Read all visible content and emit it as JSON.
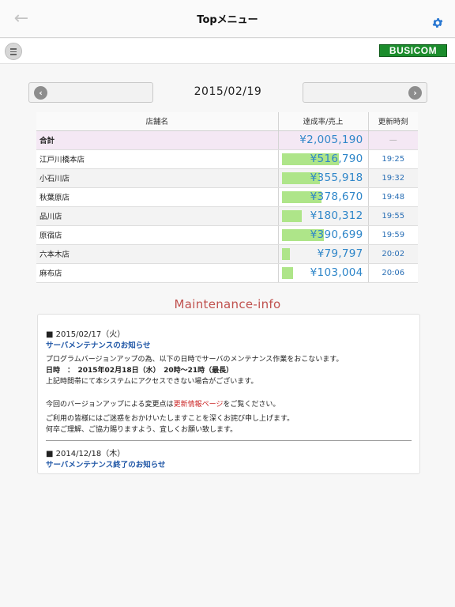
{
  "nav": {
    "back_icon": "←",
    "title": "Topメニュー",
    "settings_icon": "gear-icon",
    "accent_color": "#2a78d2"
  },
  "toolbar": {
    "menu_icon": "menu-icon",
    "logo_text": "BUSICOM"
  },
  "date_nav": {
    "prev_icon": "‹",
    "date": "2015/02/19",
    "next_icon": "›"
  },
  "table": {
    "headers": {
      "name": "店舗名",
      "rate": "達成率/売上",
      "time": "更新時刻"
    },
    "total": {
      "name": "合計",
      "amount": "¥2,005,190",
      "time": "—"
    },
    "rows": [
      {
        "name": "江戸川橋本店",
        "amount": "¥516,790",
        "time": "19:25",
        "rate_fraction": 0.72
      },
      {
        "name": "小石川店",
        "amount": "¥355,918",
        "time": "19:32",
        "rate_fraction": 0.48
      },
      {
        "name": "秋葉原店",
        "amount": "¥378,670",
        "time": "19:48",
        "rate_fraction": 0.5
      },
      {
        "name": "品川店",
        "amount": "¥180,312",
        "time": "19:55",
        "rate_fraction": 0.25
      },
      {
        "name": "原宿店",
        "amount": "¥390,699",
        "time": "19:59",
        "rate_fraction": 0.53
      },
      {
        "name": "六本木店",
        "amount": "¥79,797",
        "time": "20:02",
        "rate_fraction": 0.1
      },
      {
        "name": "麻布店",
        "amount": "¥103,004",
        "time": "20:06",
        "rate_fraction": 0.14
      }
    ],
    "bar_color": "#aee589",
    "amount_color": "#2e86c9"
  },
  "maintenance": {
    "heading": "Maintenance-info",
    "notice1": {
      "date": "■ 2015/02/17（火）",
      "title": "サーバメンテナンスのお知らせ",
      "line1": "プログラムバージョンアップの為、以下の日時でサーバのメンテナンス作業をおこないます。",
      "line2": "日時　：　2015年02月18日（水）　20時～21時（最長）",
      "line3": "上記時間帯にて本システムにアクセスできない場合がございます。",
      "line4_pre": "今回のバージョンアップによる変更点は",
      "line4_link": "更新情報ページ",
      "line4_post": "をご覧ください。",
      "line5": "ご利用の皆様にはご迷惑をおかけいたしますことを深くお詫び申し上げます。",
      "line6": "何卒ご理解、ご協力賜りますよう、宜しくお願い致します。"
    },
    "notice2": {
      "date": "■ 2014/12/18（木）",
      "title": "サーバメンテナンス終了のお知らせ"
    }
  }
}
